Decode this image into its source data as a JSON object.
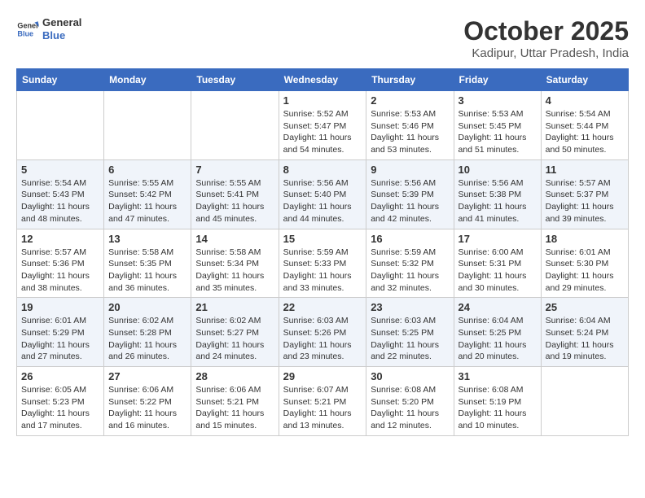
{
  "header": {
    "logo_line1": "General",
    "logo_line2": "Blue",
    "title": "October 2025",
    "subtitle": "Kadipur, Uttar Pradesh, India"
  },
  "weekdays": [
    "Sunday",
    "Monday",
    "Tuesday",
    "Wednesday",
    "Thursday",
    "Friday",
    "Saturday"
  ],
  "weeks": [
    [
      {
        "day": "",
        "info": ""
      },
      {
        "day": "",
        "info": ""
      },
      {
        "day": "",
        "info": ""
      },
      {
        "day": "1",
        "info": "Sunrise: 5:52 AM\nSunset: 5:47 PM\nDaylight: 11 hours and 54 minutes."
      },
      {
        "day": "2",
        "info": "Sunrise: 5:53 AM\nSunset: 5:46 PM\nDaylight: 11 hours and 53 minutes."
      },
      {
        "day": "3",
        "info": "Sunrise: 5:53 AM\nSunset: 5:45 PM\nDaylight: 11 hours and 51 minutes."
      },
      {
        "day": "4",
        "info": "Sunrise: 5:54 AM\nSunset: 5:44 PM\nDaylight: 11 hours and 50 minutes."
      }
    ],
    [
      {
        "day": "5",
        "info": "Sunrise: 5:54 AM\nSunset: 5:43 PM\nDaylight: 11 hours and 48 minutes."
      },
      {
        "day": "6",
        "info": "Sunrise: 5:55 AM\nSunset: 5:42 PM\nDaylight: 11 hours and 47 minutes."
      },
      {
        "day": "7",
        "info": "Sunrise: 5:55 AM\nSunset: 5:41 PM\nDaylight: 11 hours and 45 minutes."
      },
      {
        "day": "8",
        "info": "Sunrise: 5:56 AM\nSunset: 5:40 PM\nDaylight: 11 hours and 44 minutes."
      },
      {
        "day": "9",
        "info": "Sunrise: 5:56 AM\nSunset: 5:39 PM\nDaylight: 11 hours and 42 minutes."
      },
      {
        "day": "10",
        "info": "Sunrise: 5:56 AM\nSunset: 5:38 PM\nDaylight: 11 hours and 41 minutes."
      },
      {
        "day": "11",
        "info": "Sunrise: 5:57 AM\nSunset: 5:37 PM\nDaylight: 11 hours and 39 minutes."
      }
    ],
    [
      {
        "day": "12",
        "info": "Sunrise: 5:57 AM\nSunset: 5:36 PM\nDaylight: 11 hours and 38 minutes."
      },
      {
        "day": "13",
        "info": "Sunrise: 5:58 AM\nSunset: 5:35 PM\nDaylight: 11 hours and 36 minutes."
      },
      {
        "day": "14",
        "info": "Sunrise: 5:58 AM\nSunset: 5:34 PM\nDaylight: 11 hours and 35 minutes."
      },
      {
        "day": "15",
        "info": "Sunrise: 5:59 AM\nSunset: 5:33 PM\nDaylight: 11 hours and 33 minutes."
      },
      {
        "day": "16",
        "info": "Sunrise: 5:59 AM\nSunset: 5:32 PM\nDaylight: 11 hours and 32 minutes."
      },
      {
        "day": "17",
        "info": "Sunrise: 6:00 AM\nSunset: 5:31 PM\nDaylight: 11 hours and 30 minutes."
      },
      {
        "day": "18",
        "info": "Sunrise: 6:01 AM\nSunset: 5:30 PM\nDaylight: 11 hours and 29 minutes."
      }
    ],
    [
      {
        "day": "19",
        "info": "Sunrise: 6:01 AM\nSunset: 5:29 PM\nDaylight: 11 hours and 27 minutes."
      },
      {
        "day": "20",
        "info": "Sunrise: 6:02 AM\nSunset: 5:28 PM\nDaylight: 11 hours and 26 minutes."
      },
      {
        "day": "21",
        "info": "Sunrise: 6:02 AM\nSunset: 5:27 PM\nDaylight: 11 hours and 24 minutes."
      },
      {
        "day": "22",
        "info": "Sunrise: 6:03 AM\nSunset: 5:26 PM\nDaylight: 11 hours and 23 minutes."
      },
      {
        "day": "23",
        "info": "Sunrise: 6:03 AM\nSunset: 5:25 PM\nDaylight: 11 hours and 22 minutes."
      },
      {
        "day": "24",
        "info": "Sunrise: 6:04 AM\nSunset: 5:25 PM\nDaylight: 11 hours and 20 minutes."
      },
      {
        "day": "25",
        "info": "Sunrise: 6:04 AM\nSunset: 5:24 PM\nDaylight: 11 hours and 19 minutes."
      }
    ],
    [
      {
        "day": "26",
        "info": "Sunrise: 6:05 AM\nSunset: 5:23 PM\nDaylight: 11 hours and 17 minutes."
      },
      {
        "day": "27",
        "info": "Sunrise: 6:06 AM\nSunset: 5:22 PM\nDaylight: 11 hours and 16 minutes."
      },
      {
        "day": "28",
        "info": "Sunrise: 6:06 AM\nSunset: 5:21 PM\nDaylight: 11 hours and 15 minutes."
      },
      {
        "day": "29",
        "info": "Sunrise: 6:07 AM\nSunset: 5:21 PM\nDaylight: 11 hours and 13 minutes."
      },
      {
        "day": "30",
        "info": "Sunrise: 6:08 AM\nSunset: 5:20 PM\nDaylight: 11 hours and 12 minutes."
      },
      {
        "day": "31",
        "info": "Sunrise: 6:08 AM\nSunset: 5:19 PM\nDaylight: 11 hours and 10 minutes."
      },
      {
        "day": "",
        "info": ""
      }
    ]
  ]
}
